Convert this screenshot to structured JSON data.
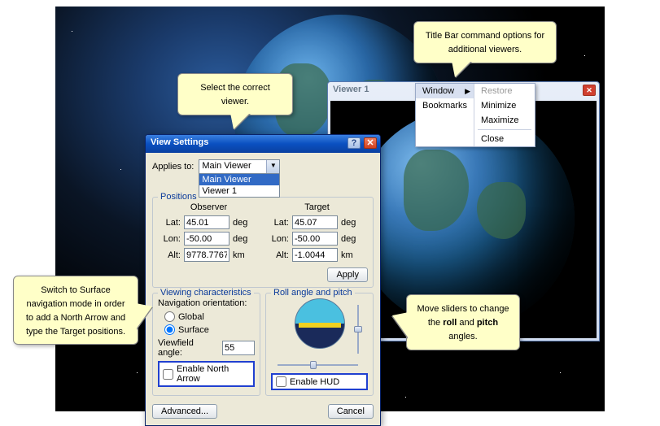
{
  "viewer1": {
    "title": "Viewer 1"
  },
  "context_menu": {
    "col1": [
      "Window",
      "Bookmarks"
    ],
    "col2": {
      "restore": "Restore",
      "minimize": "Minimize",
      "maximize": "Maximize",
      "close": "Close"
    }
  },
  "dialog": {
    "title": "View Settings",
    "applies_to_label": "Applies to:",
    "applies_to_value": "Main Viewer",
    "applies_to_options": [
      "Main Viewer",
      "Viewer 1"
    ],
    "positions": {
      "legend": "Positions",
      "observer_heading": "Observer",
      "target_heading": "Target",
      "lat_label": "Lat:",
      "lon_label": "Lon:",
      "alt_label": "Alt:",
      "unit_deg": "deg",
      "unit_km": "km",
      "observer": {
        "lat": "45.01",
        "lon": "-50.00",
        "alt": "9778.7767"
      },
      "target": {
        "lat": "45.07",
        "lon": "-50.00",
        "alt": "-1.0044"
      },
      "apply": "Apply"
    },
    "viewing": {
      "legend": "Viewing characteristics",
      "nav_label": "Navigation orientation:",
      "global": "Global",
      "surface": "Surface",
      "viewfield_label": "Viewfield angle:",
      "viewfield_value": "55",
      "enable_north": "Enable North Arrow"
    },
    "roll": {
      "legend": "Roll angle and pitch",
      "enable_hud": "Enable HUD"
    },
    "advanced": "Advanced...",
    "cancel": "Cancel"
  },
  "callouts": {
    "c1": "Select the correct viewer.",
    "c2": "Title Bar command options for additional viewers.",
    "c3_a": "Switch to Surface navigation mode in order to add a North Arrow and type the Target positions.",
    "c4_a": "Move sliders to change the ",
    "c4_b": "roll",
    "c4_c": " and ",
    "c4_d": "pitch",
    "c4_e": " angles."
  }
}
